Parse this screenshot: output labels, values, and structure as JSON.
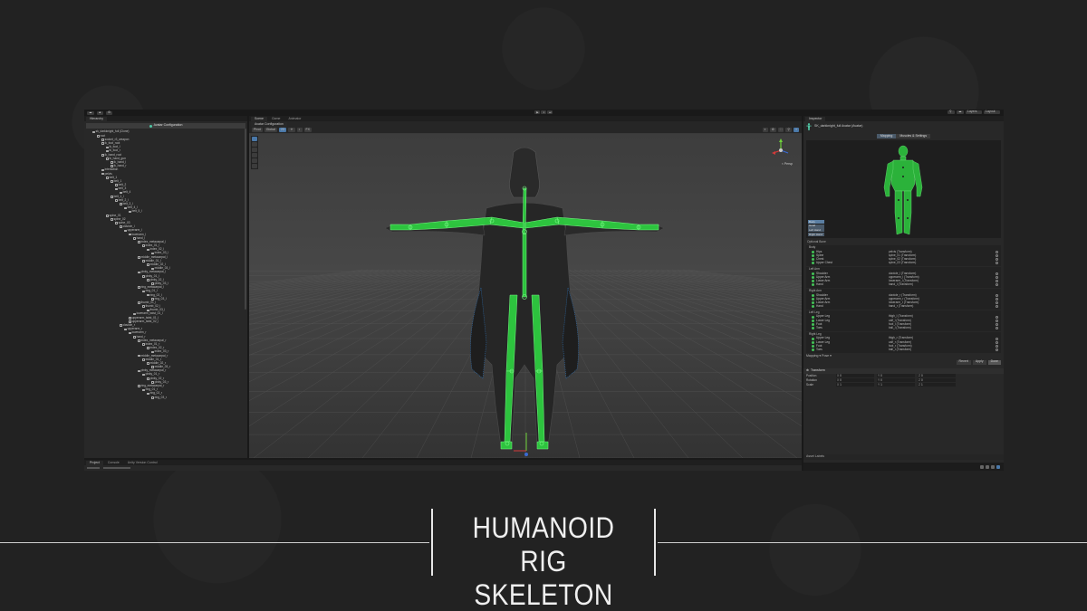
{
  "caption": {
    "line1": "HUMANOID RIG",
    "line2": "SKELETON"
  },
  "menubar": {
    "left_buttons": [
      "☁",
      "▲",
      "⚙"
    ],
    "play_controls": [
      "▶",
      "⏸",
      "⏭"
    ],
    "right_buttons": [
      "⚲",
      "☁",
      "Layers",
      "Layout"
    ]
  },
  "hierarchy": {
    "tab": "Hierarchy",
    "banner": "Avatar Configuration",
    "items": [
      {
        "depth": 1,
        "name": "sk_darkknight_full (Clone)"
      },
      {
        "depth": 2,
        "name": "root"
      },
      {
        "depth": 3,
        "name": "socket_r3_weapon"
      },
      {
        "depth": 3,
        "name": "ik_foot_root"
      },
      {
        "depth": 4,
        "name": "ik_foot_l"
      },
      {
        "depth": 4,
        "name": "ik_foot_r"
      },
      {
        "depth": 3,
        "name": "ik_hand_root"
      },
      {
        "depth": 4,
        "name": "ik_hand_gun"
      },
      {
        "depth": 5,
        "name": "ik_hand_l"
      },
      {
        "depth": 5,
        "name": "ik_hand_r"
      },
      {
        "depth": 3,
        "name": "interaction"
      },
      {
        "depth": 3,
        "name": "pelvis"
      },
      {
        "depth": 4,
        "name": "belt_1"
      },
      {
        "depth": 5,
        "name": "belt_1"
      },
      {
        "depth": 6,
        "name": "belt_2"
      },
      {
        "depth": 6,
        "name": "belt_3"
      },
      {
        "depth": 7,
        "name": "belt_4"
      },
      {
        "depth": 5,
        "name": "belt_1_l"
      },
      {
        "depth": 6,
        "name": "belt_2_l"
      },
      {
        "depth": 7,
        "name": "belt_3_l"
      },
      {
        "depth": 8,
        "name": "belt_4_l"
      },
      {
        "depth": 9,
        "name": "belt_5_l"
      },
      {
        "depth": 4,
        "name": "spine_01"
      },
      {
        "depth": 5,
        "name": "spine_02"
      },
      {
        "depth": 6,
        "name": "spine_03"
      },
      {
        "depth": 7,
        "name": "clavicle_l"
      },
      {
        "depth": 8,
        "name": "upperarm_l"
      },
      {
        "depth": 9,
        "name": "lowerarm_l"
      },
      {
        "depth": 10,
        "name": "hand_l"
      },
      {
        "depth": 11,
        "name": "index_metacarpal_l"
      },
      {
        "depth": 12,
        "name": "index_01_l"
      },
      {
        "depth": 13,
        "name": "index_02_l"
      },
      {
        "depth": 14,
        "name": "index_03_l"
      },
      {
        "depth": 11,
        "name": "middle_metacarpal_l"
      },
      {
        "depth": 12,
        "name": "middle_01_l"
      },
      {
        "depth": 13,
        "name": "middle_02_l"
      },
      {
        "depth": 14,
        "name": "middle_03_l"
      },
      {
        "depth": 11,
        "name": "pinky_metacarpal_l"
      },
      {
        "depth": 12,
        "name": "pinky_01_l"
      },
      {
        "depth": 13,
        "name": "pinky_02_l"
      },
      {
        "depth": 14,
        "name": "pinky_03_l"
      },
      {
        "depth": 11,
        "name": "ring_metacarpal_l"
      },
      {
        "depth": 12,
        "name": "ring_01_l"
      },
      {
        "depth": 13,
        "name": "ring_02_l"
      },
      {
        "depth": 14,
        "name": "ring_03_l"
      },
      {
        "depth": 11,
        "name": "thumb_01_l"
      },
      {
        "depth": 12,
        "name": "thumb_02_l"
      },
      {
        "depth": 13,
        "name": "thumb_03_l"
      },
      {
        "depth": 10,
        "name": "lowerarm_twist_01_l"
      },
      {
        "depth": 9,
        "name": "upperarm_twist_01_l"
      },
      {
        "depth": 9,
        "name": "upperarm_twist_02_l"
      },
      {
        "depth": 7,
        "name": "clavicle_r"
      },
      {
        "depth": 8,
        "name": "upperarm_r"
      },
      {
        "depth": 9,
        "name": "lowerarm_r"
      },
      {
        "depth": 10,
        "name": "hand_r"
      },
      {
        "depth": 11,
        "name": "index_metacarpal_r"
      },
      {
        "depth": 12,
        "name": "index_01_r"
      },
      {
        "depth": 13,
        "name": "index_02_r"
      },
      {
        "depth": 14,
        "name": "index_03_r"
      },
      {
        "depth": 11,
        "name": "middle_metacarpal_r"
      },
      {
        "depth": 12,
        "name": "middle_01_r"
      },
      {
        "depth": 13,
        "name": "middle_02_r"
      },
      {
        "depth": 14,
        "name": "middle_03_r"
      },
      {
        "depth": 11,
        "name": "pinky_metacarpal_r"
      },
      {
        "depth": 12,
        "name": "pinky_01_r"
      },
      {
        "depth": 13,
        "name": "pinky_02_r"
      },
      {
        "depth": 14,
        "name": "pinky_03_r"
      },
      {
        "depth": 11,
        "name": "ring_metacarpal_r"
      },
      {
        "depth": 12,
        "name": "ring_01_r"
      },
      {
        "depth": 13,
        "name": "ring_02_r"
      },
      {
        "depth": 14,
        "name": "ring_03_r"
      }
    ]
  },
  "scene": {
    "tabs": [
      "Scene",
      "Game",
      "Animator"
    ],
    "sub_tab": "Avatar Configuration",
    "toolbar_left": [
      "Pivot",
      "Global"
    ],
    "toolbar_mid": [
      "2D",
      "☀",
      "♪",
      "FX"
    ],
    "toolbar_right": [
      "◐",
      "⚙",
      "⛶",
      "⚲",
      "≡"
    ],
    "gizmo_label": "< Persp",
    "bone_color": "#2ecc40"
  },
  "inspector": {
    "tab": "Inspector",
    "object_name": "SK_darkknight_full Avatar (Avatar)",
    "mapping_tabs": [
      "Mapping",
      "Muscles & Settings"
    ],
    "body_parts": [
      "Body",
      "Head",
      "Left Hand",
      "Right Hand"
    ],
    "optional_label": "Optional Bone",
    "groups": [
      {
        "title": "Body",
        "bones": [
          {
            "name": "Hips",
            "value": "pelvis (Transform)"
          },
          {
            "name": "Spine",
            "value": "spine_01 (Transform)"
          },
          {
            "name": "Chest",
            "value": "spine_02 (Transform)"
          },
          {
            "name": "Upper Chest",
            "value": "spine_03 (Transform)"
          }
        ]
      },
      {
        "title": "Left Arm",
        "bones": [
          {
            "name": "Shoulder",
            "value": "clavicle_l (Transform)"
          },
          {
            "name": "Upper Arm",
            "value": "upperarm_l (Transform)"
          },
          {
            "name": "Lower Arm",
            "value": "lowerarm_l (Transform)"
          },
          {
            "name": "Hand",
            "value": "hand_l (Transform)"
          }
        ]
      },
      {
        "title": "Right Arm",
        "bones": [
          {
            "name": "Shoulder",
            "value": "clavicle_r (Transform)"
          },
          {
            "name": "Upper Arm",
            "value": "upperarm_r (Transform)"
          },
          {
            "name": "Lower Arm",
            "value": "lowerarm_r (Transform)"
          },
          {
            "name": "Hand",
            "value": "hand_r (Transform)"
          }
        ]
      },
      {
        "title": "Left Leg",
        "bones": [
          {
            "name": "Upper Leg",
            "value": "thigh_l (Transform)"
          },
          {
            "name": "Lower Leg",
            "value": "calf_l (Transform)"
          },
          {
            "name": "Foot",
            "value": "foot_l (Transform)"
          },
          {
            "name": "Toes",
            "value": "ball_l (Transform)"
          }
        ]
      },
      {
        "title": "Right Leg",
        "bones": [
          {
            "name": "Upper Leg",
            "value": "thigh_r (Transform)"
          },
          {
            "name": "Lower Leg",
            "value": "calf_r (Transform)"
          },
          {
            "name": "Foot",
            "value": "foot_r (Transform)"
          },
          {
            "name": "Toes",
            "value": "ball_r (Transform)"
          }
        ]
      }
    ],
    "mapping_footer": "Mapping ▾   Pose ▾",
    "footer_buttons": [
      "Revert",
      "Apply",
      "Done"
    ],
    "transform": {
      "title": "Transform",
      "rows": [
        {
          "label": "Position",
          "x": "0",
          "y": "0",
          "z": "0"
        },
        {
          "label": "Rotation",
          "x": "0",
          "y": "0",
          "z": "0"
        },
        {
          "label": "Scale",
          "x": "1",
          "y": "1",
          "z": "1"
        }
      ]
    },
    "asset_labels": "Asset Labels"
  },
  "project": {
    "tabs": [
      "Project",
      "Console",
      "Unity Version Control"
    ]
  }
}
